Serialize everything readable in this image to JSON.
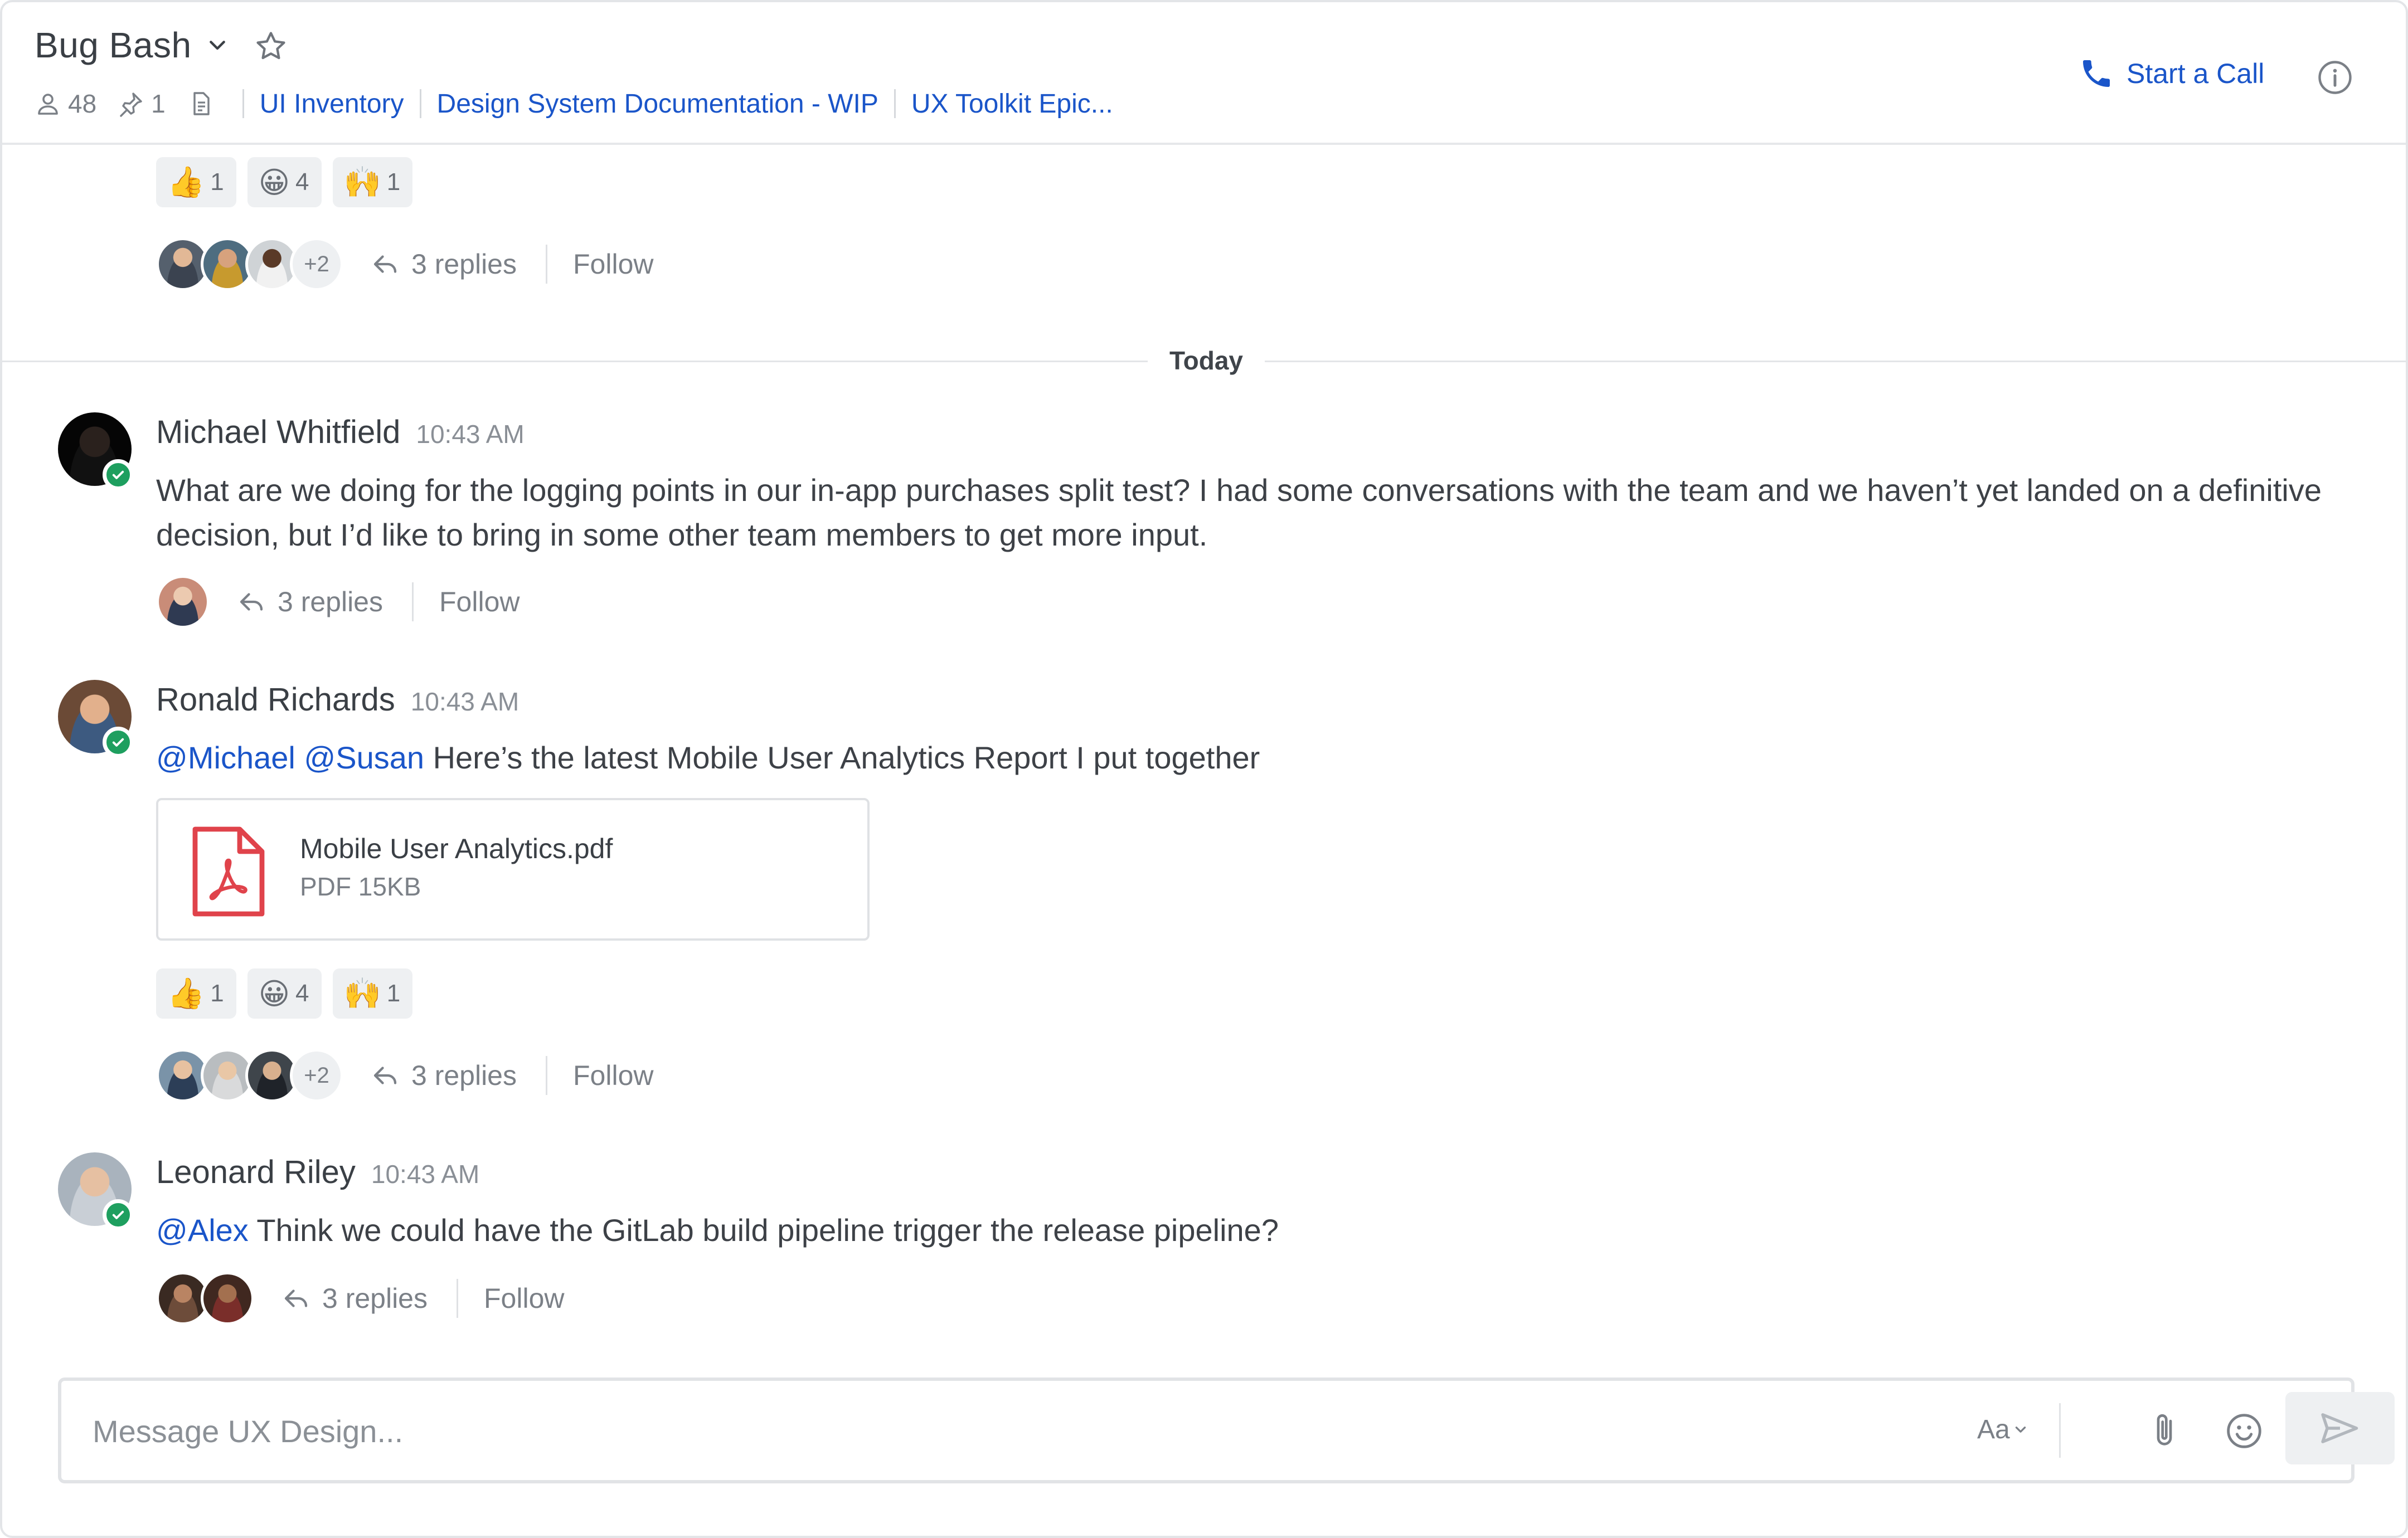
{
  "header": {
    "channel_title": "Bug Bash",
    "member_count": "48",
    "pinned_count": "1",
    "links": [
      "UI Inventory",
      "Design System Documentation - WIP",
      "UX Toolkit Epic..."
    ],
    "start_call_label": "Start a Call"
  },
  "previous": {
    "reactions": [
      {
        "emoji": "👍",
        "count": "1"
      },
      {
        "emoji": "😀",
        "count": "4"
      },
      {
        "emoji": "🙌",
        "count": "1"
      }
    ],
    "more_participants": "+2",
    "replies": "3 replies",
    "follow": "Follow"
  },
  "divider": {
    "label": "Today"
  },
  "messages": [
    {
      "author": "Michael Whitfield",
      "time": "10:43 AM",
      "text": "What are we doing for the logging points in our in-app purchases split test? I had some conversations with the team and we haven’t yet landed on a definitive decision, but I’d like to bring in some other team members to get more input.",
      "replies": "3 replies",
      "follow": "Follow"
    },
    {
      "author": "Ronald Richards",
      "time": "10:43 AM",
      "mentions": [
        "@Michael",
        "@Susan"
      ],
      "text": "Here’s the latest Mobile User Analytics Report I put together",
      "attachment": {
        "name": "Mobile User Analytics.pdf",
        "meta": "PDF 15KB"
      },
      "reactions": [
        {
          "emoji": "👍",
          "count": "1"
        },
        {
          "emoji": "😀",
          "count": "4"
        },
        {
          "emoji": "🙌",
          "count": "1"
        }
      ],
      "more_participants": "+2",
      "replies": "3 replies",
      "follow": "Follow"
    },
    {
      "author": "Leonard Riley",
      "time": "10:43 AM",
      "mention": "@Alex",
      "text": "Think we could have the GitLab build pipeline trigger the release pipeline?",
      "replies": "3 replies",
      "follow": "Follow"
    }
  ],
  "composer": {
    "placeholder": "Message UX Design...",
    "format_label": "Aa"
  },
  "colors": {
    "link": "#1a55c9",
    "presence": "#1e9f5f",
    "pdf": "#e0434b"
  }
}
